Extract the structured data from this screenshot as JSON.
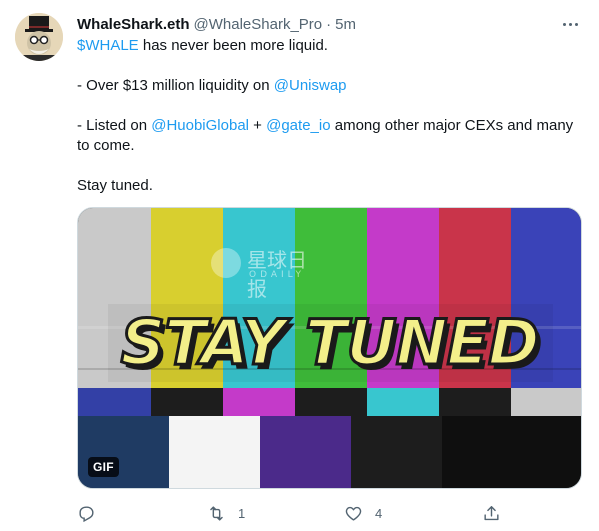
{
  "author": {
    "display_name": "WhaleShark.eth",
    "handle": "@WhaleShark_Pro",
    "separator": "·",
    "timestamp": "5m"
  },
  "tweet": {
    "line1_cashtag": "$WHALE",
    "line1_rest": " has never been more liquid.",
    "line2_prefix": "- Over $13 million liquidity on ",
    "line2_mention": "@Uniswap",
    "line3_prefix": "- Listed on ",
    "line3_mention1": "@HuobiGlobal",
    "line3_mid": " + ",
    "line3_mention2": "@gate_io",
    "line3_rest": " among other major CEXs and many to come.",
    "line4": "Stay tuned."
  },
  "media": {
    "gif_text": "STAY TUNED",
    "badge": "GIF",
    "watermark": "星球日报",
    "watermark_sub": "ODAILY"
  },
  "actions": {
    "reply_count": "",
    "retweet_count": "1",
    "like_count": "4",
    "share_count": ""
  },
  "colors": {
    "link": "#1d9bf0",
    "secondary_text": "#536471"
  },
  "icons": [
    "reply-icon",
    "retweet-icon",
    "like-icon",
    "share-icon",
    "more-icon"
  ]
}
